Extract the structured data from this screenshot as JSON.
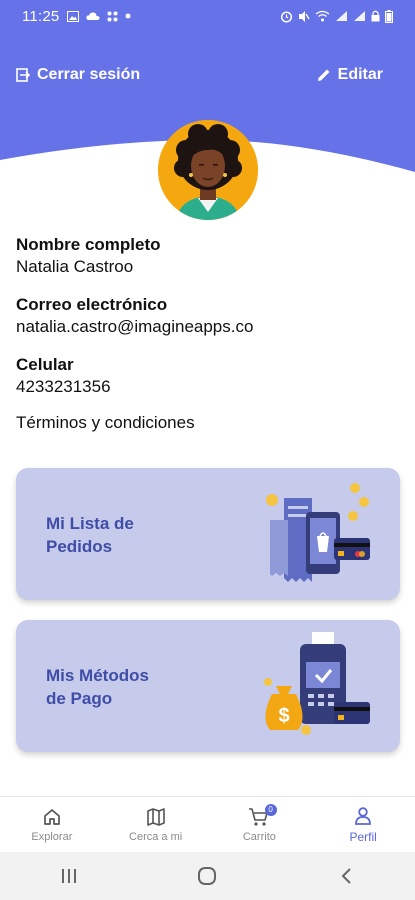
{
  "status_bar": {
    "time": "11:25"
  },
  "header": {
    "logout_label": "Cerrar sesión",
    "edit_label": "Editar",
    "background_color": "#6673e8"
  },
  "profile": {
    "name_label": "Nombre completo",
    "name_value": "Natalia Castroo",
    "email_label": "Correo electrónico",
    "email_value": "natalia.castro@imagineapps.co",
    "phone_label": "Celular",
    "phone_value": "4233231356",
    "terms_label": "Términos y condiciones"
  },
  "cards": {
    "orders_line1": "Mi Lista de",
    "orders_line2": "Pedidos",
    "payment_line1": "Mis Métodos",
    "payment_line2": "de Pago",
    "card_color": "#c6cbec",
    "title_color": "#3f4da6"
  },
  "bottom_nav": {
    "items": [
      {
        "label": "Explorar",
        "icon": "home-icon"
      },
      {
        "label": "Cerca a mi",
        "icon": "map-icon"
      },
      {
        "label": "Carrito",
        "icon": "cart-icon",
        "badge": "0"
      },
      {
        "label": "Perfil",
        "icon": "person-icon",
        "active": true
      }
    ]
  },
  "system_nav": {
    "icons": [
      "recents-icon",
      "home-circle-icon",
      "back-icon"
    ]
  }
}
